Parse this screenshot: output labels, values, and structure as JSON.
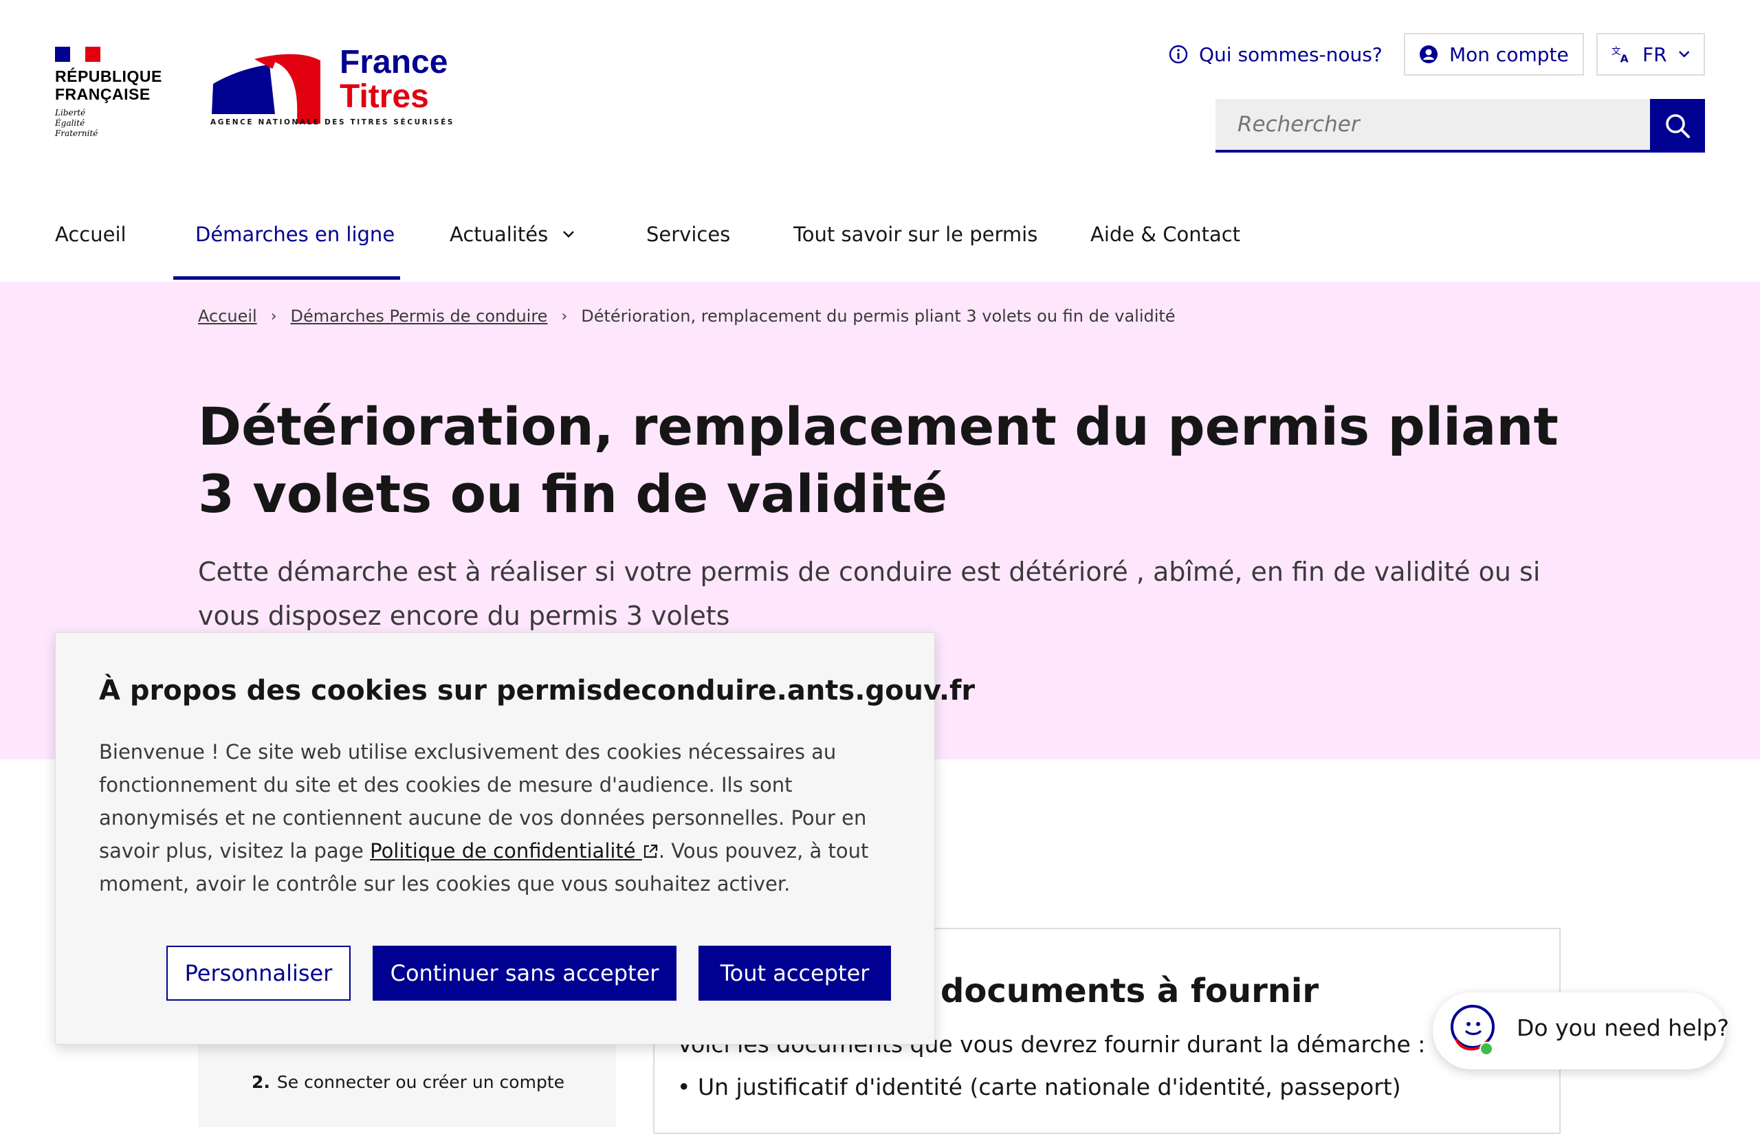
{
  "header": {
    "republique": [
      "RÉPUBLIQUE",
      "FRANÇAISE"
    ],
    "motto": [
      "Liberté",
      "Égalité",
      "Fraternité"
    ],
    "brand": {
      "line1": "France",
      "line2": "Titres",
      "agency": "AGENCE NATIONALE DES TITRES SÉCURISÉS"
    },
    "links": {
      "about": "Qui sommes-nous?",
      "account": "Mon compte",
      "language": "FR"
    },
    "search": {
      "placeholder": "Rechercher"
    }
  },
  "nav": {
    "items": [
      "Accueil",
      "Démarches en ligne",
      "Actualités",
      "Services",
      "Tout savoir sur le permis",
      "Aide & Contact"
    ],
    "active_index": 1
  },
  "breadcrumb": {
    "items": [
      "Accueil",
      "Démarches Permis de conduire",
      "Détérioration, remplacement du permis pliant 3 volets ou fin de validité"
    ]
  },
  "hero": {
    "title": "Détérioration, remplacement du permis pliant 3 volets ou fin de validité",
    "lead": "Cette démarche est à réaliser si votre permis de conduire est détérioré , abîmé, en fin de validité ou si vous disposez encore du permis 3 volets"
  },
  "content": {
    "step2_number": "2.",
    "step2_label": "Se connecter ou créer un compte",
    "documents_title": "documents à fournir",
    "documents_intro": "Voici les documents que vous devrez fournir durant la démarche :",
    "documents_item": "Un justificatif d'identité (carte nationale d'identité, passeport)"
  },
  "cookie": {
    "title": "À propos des cookies sur permisdeconduire.ants.gouv.fr",
    "body_before": "Bienvenue ! Ce site web utilise exclusivement des cookies nécessaires au fonctionnement du site et des cookies de mesure d'audience. Ils sont anonymisés et ne contiennent aucune de vos données personnelles. Pour en savoir plus, visitez la page ",
    "link": "Politique de confidentialité",
    "body_after": ". Vous pouvez, à tout moment, avoir le contrôle sur les cookies que vous souhaitez activer.",
    "buttons": {
      "customize": "Personnaliser",
      "continue": "Continuer sans accepter",
      "accept": "Tout accepter"
    }
  },
  "help": {
    "label": "Do you need help?"
  },
  "colors": {
    "primary": "#000091",
    "red": "#e1000f",
    "hero_bg": "#fee7fc",
    "modal_bg": "#f6f6f6"
  }
}
